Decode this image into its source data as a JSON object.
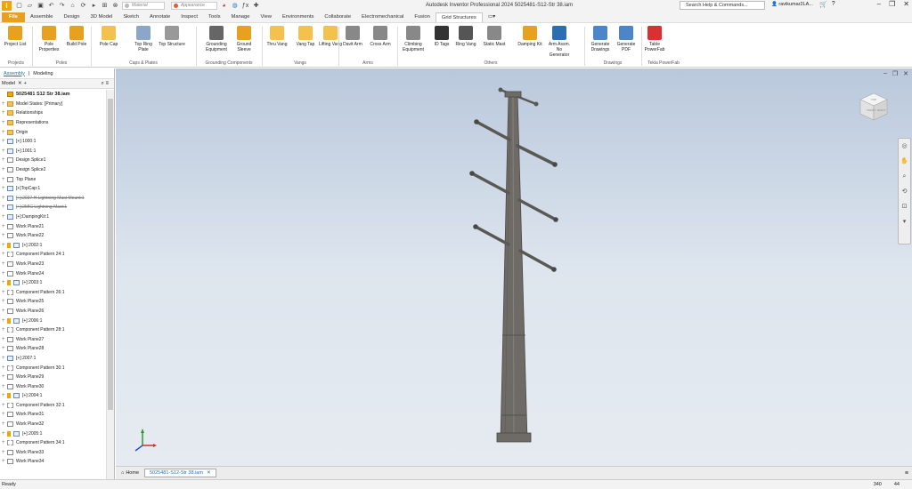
{
  "titlebar": {
    "app_title": "Autodesk Inventor Professional 2024   5025481-S12-Str 38.iam",
    "material_placeholder": "Material",
    "appearance_placeholder": "Appearance",
    "search_text": "Search Help & Commands...",
    "user": "ravikumar2LA..."
  },
  "tabs": [
    "File",
    "Assemble",
    "Design",
    "3D Model",
    "Sketch",
    "Annotate",
    "Inspect",
    "Tools",
    "Manage",
    "View",
    "Environments",
    "Collaborate",
    "Electromechanical",
    "Fusion",
    "Grid Structures"
  ],
  "ribbon": {
    "buttons": [
      {
        "label": "Project List",
        "icon": "project-list-icon",
        "color": "#e8a020"
      },
      {
        "label": "Pole Properties",
        "icon": "pole-properties-icon",
        "color": "#e8a020"
      },
      {
        "label": "Build Pole",
        "icon": "build-pole-icon",
        "color": "#e8a020"
      },
      {
        "label": "Pole Cap",
        "icon": "pole-cap-icon",
        "color": "#f2c14e"
      },
      {
        "label": "Top Ring Plate",
        "icon": "ring-plate-icon",
        "color": "#8aa6c8"
      },
      {
        "label": "Top Structure",
        "icon": "top-structure-icon",
        "color": "#999999"
      },
      {
        "label": "Grounding Equipment",
        "icon": "grounding-icon",
        "color": "#666666"
      },
      {
        "label": "Ground Sleeve",
        "icon": "ground-sleeve-icon",
        "color": "#e8a020"
      },
      {
        "label": "Thru Vang",
        "icon": "thru-vang-icon",
        "color": "#f2c14e"
      },
      {
        "label": "Vang Tap",
        "icon": "vang-tap-icon",
        "color": "#f2c14e"
      },
      {
        "label": "Lifting Vang",
        "icon": "lifting-vang-icon",
        "color": "#f2c14e"
      },
      {
        "label": "Davit Arm",
        "icon": "davit-arm-icon",
        "color": "#888888"
      },
      {
        "label": "Cross Arm",
        "icon": "cross-arm-icon",
        "color": "#888888"
      },
      {
        "label": "Climbing Equipment",
        "icon": "climbing-icon",
        "color": "#888888"
      },
      {
        "label": "ID Tags",
        "icon": "id-tags-icon",
        "color": "#333333"
      },
      {
        "label": "Ring Vang",
        "icon": "ring-vang-icon",
        "color": "#555555"
      },
      {
        "label": "Static Mast",
        "icon": "static-mast-icon",
        "color": "#888888"
      },
      {
        "label": "Damping Kit",
        "icon": "damping-kit-icon",
        "color": "#e8a020"
      },
      {
        "label": "Arm Assm. No Generator",
        "icon": "arm-generator-icon",
        "color": "#2a6fb0"
      },
      {
        "label": "Generate Drawings",
        "icon": "generate-drawings-icon",
        "color": "#4a86c8"
      },
      {
        "label": "Generate PDF",
        "icon": "generate-pdf-icon",
        "color": "#4a86c8"
      },
      {
        "label": "Table PowerFab",
        "icon": "table-powerfab-icon",
        "color": "#d93030"
      }
    ],
    "groups": [
      "Projects",
      "Poles",
      "Caps & Plates",
      "Grounding Components",
      "Vangs",
      "Arms",
      "Others",
      "Drawings",
      "Tekla PowerFab"
    ]
  },
  "browser": {
    "tab_assembly": "Assembly",
    "tab_modeling": "Modeling",
    "header": "Model",
    "items": [
      {
        "label": "5025481 S12 Str 38.iam",
        "type": "root"
      },
      {
        "label": "Model States: [Primary]",
        "type": "folder"
      },
      {
        "label": "Relationships",
        "type": "folder"
      },
      {
        "label": "Representations",
        "type": "folder"
      },
      {
        "label": "Origin",
        "type": "folder"
      },
      {
        "label": "[+]:1000:1",
        "type": "part"
      },
      {
        "label": "[+]:1001:1",
        "type": "part"
      },
      {
        "label": "Design Splice1",
        "type": "plane"
      },
      {
        "label": "Design Splice2",
        "type": "plane"
      },
      {
        "label": "Top Plane",
        "type": "plane"
      },
      {
        "label": "[+]TopCap:1",
        "type": "part"
      },
      {
        "label": "[+]:2037 H Lightning Mast Mount:1",
        "type": "strike"
      },
      {
        "label": "[+]:2MIC Lightning Mast:1",
        "type": "strike"
      },
      {
        "label": "[+]:DampingKit:1",
        "type": "part"
      },
      {
        "label": "Work Plane21",
        "type": "plane"
      },
      {
        "label": "Work Plane22",
        "type": "plane"
      },
      {
        "label": "[+]:2002:1",
        "type": "bolt"
      },
      {
        "label": "Component Pattern 24:1",
        "type": "pattern"
      },
      {
        "label": "Work Plane23",
        "type": "plane"
      },
      {
        "label": "Work Plane24",
        "type": "plane"
      },
      {
        "label": "[+]:2003:1",
        "type": "bolt"
      },
      {
        "label": "Component Pattern 26:1",
        "type": "pattern"
      },
      {
        "label": "Work Plane25",
        "type": "plane"
      },
      {
        "label": "Work Plane26",
        "type": "plane"
      },
      {
        "label": "[+]:2006:1",
        "type": "bolt"
      },
      {
        "label": "Component Pattern 28:1",
        "type": "pattern"
      },
      {
        "label": "Work Plane27",
        "type": "plane"
      },
      {
        "label": "Work Plane28",
        "type": "plane"
      },
      {
        "label": "[+]:2007:1",
        "type": "part"
      },
      {
        "label": "Component Pattern 30:1",
        "type": "pattern"
      },
      {
        "label": "Work Plane29",
        "type": "plane"
      },
      {
        "label": "Work Plane30",
        "type": "plane"
      },
      {
        "label": "[+]:2004:1",
        "type": "bolt"
      },
      {
        "label": "Component Pattern 32:1",
        "type": "pattern"
      },
      {
        "label": "Work Plane31",
        "type": "plane"
      },
      {
        "label": "Work Plane32",
        "type": "plane"
      },
      {
        "label": "[+]:2005:1",
        "type": "bolt"
      },
      {
        "label": "Component Pattern 34:1",
        "type": "pattern"
      },
      {
        "label": "Work Plane33",
        "type": "plane"
      },
      {
        "label": "Work Plane34",
        "type": "plane"
      }
    ]
  },
  "viewcube": {
    "front": "FRONT",
    "right": "RIGHT",
    "top": "TOP"
  },
  "doctabs": {
    "home": "Home",
    "document": "5025481-S12-Str 38.iam"
  },
  "status": {
    "text": "Ready",
    "count1": "340",
    "count2": "44"
  },
  "colors": {
    "file_tab": "#e8a020",
    "viewport_top": "#b9c8dc",
    "viewport_bottom": "#e6ebf1",
    "pole": "#6e6b66"
  }
}
